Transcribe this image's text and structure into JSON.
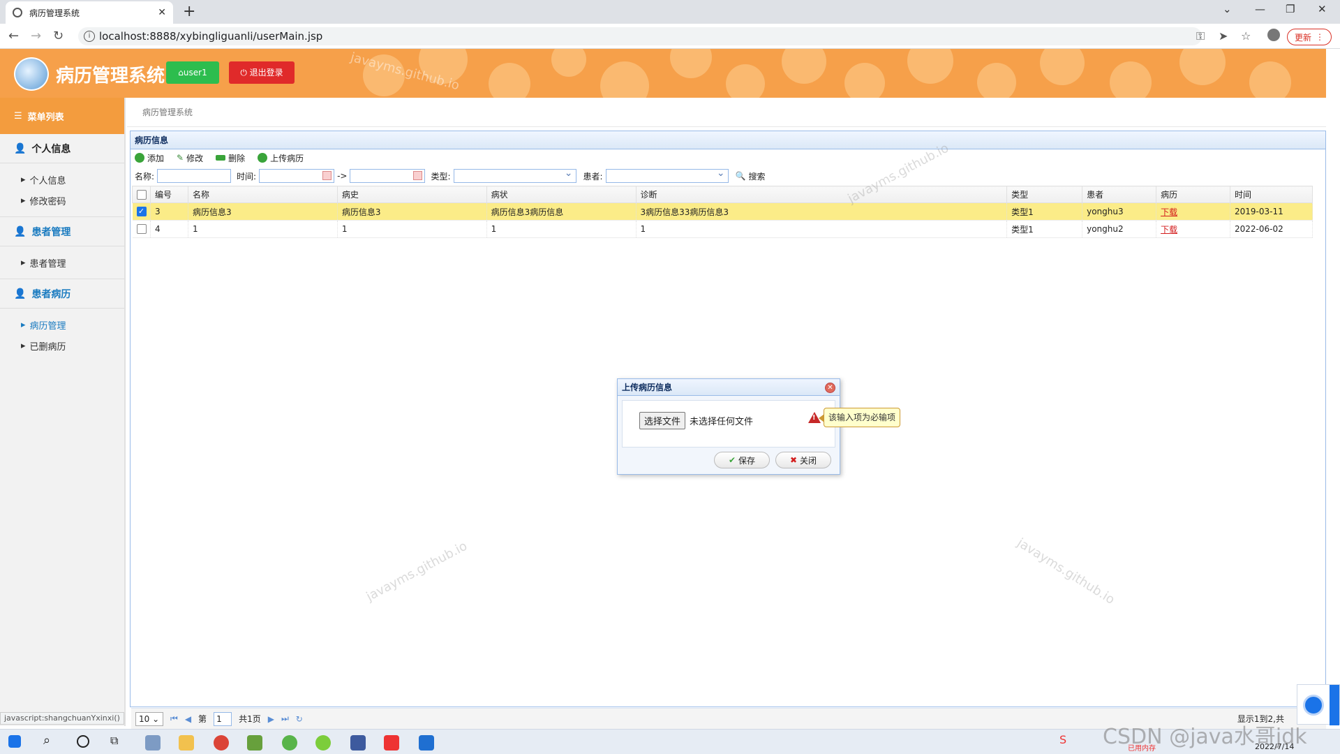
{
  "browser": {
    "tab_title": "病历管理系统",
    "url": "localhost:8888/xybingliguanli/userMain.jsp",
    "update_label": "更新",
    "status_url": "javascript:shangchuanYxinxi()"
  },
  "header": {
    "app_title": "病历管理系统",
    "user_button": "user1",
    "logout_button": "退出登录",
    "watermark": "javayms.github.io"
  },
  "sidebar": {
    "head": "菜单列表",
    "groups": [
      {
        "title": "个人信息",
        "items": [
          "个人信息",
          "修改密码"
        ]
      },
      {
        "title": "患者管理",
        "items": [
          "患者管理"
        ]
      },
      {
        "title": "患者病历",
        "items": [
          "病历管理",
          "已删病历"
        ]
      }
    ]
  },
  "breadcrumb": "病历管理系统",
  "panel": {
    "title": "病历信息",
    "toolbar": {
      "add": "添加",
      "edit": "修改",
      "delete": "删除",
      "upload": "上传病历"
    },
    "search": {
      "name_label": "名称:",
      "time_label": "时间:",
      "arrow": "->",
      "type_label": "类型:",
      "patient_label": "患者:",
      "search_button": "搜索"
    },
    "columns": [
      "编号",
      "名称",
      "病史",
      "病状",
      "诊断",
      "类型",
      "患者",
      "病历",
      "时间"
    ],
    "rows": [
      {
        "checked": true,
        "id": "3",
        "name": "病历信息3",
        "history": "病历信息3",
        "symptom": "病历信息3病历信息",
        "diagnosis": "3病历信息33病历信息3",
        "type": "类型1",
        "patient": "yonghu3",
        "record": "下载",
        "time": "2019-03-11"
      },
      {
        "checked": false,
        "id": "4",
        "name": "1",
        "history": "1",
        "symptom": "1",
        "diagnosis": "1",
        "type": "类型1",
        "patient": "yonghu2",
        "record": "下载",
        "time": "2022-06-02"
      }
    ]
  },
  "pager": {
    "page_size": "10",
    "page_prefix": "第",
    "page_value": "1",
    "page_suffix": "共1页",
    "info": "显示1到2,共"
  },
  "dialog": {
    "title": "上传病历信息",
    "choose_file": "选择文件",
    "no_file": "未选择任何文件",
    "tooltip": "该输入项为必输项",
    "save": "保存",
    "close": "关闭"
  },
  "taskbar": {
    "mem_label": "已用内存",
    "date": "2022/7/14",
    "csdn": "CSDN @java水哥jdk"
  }
}
